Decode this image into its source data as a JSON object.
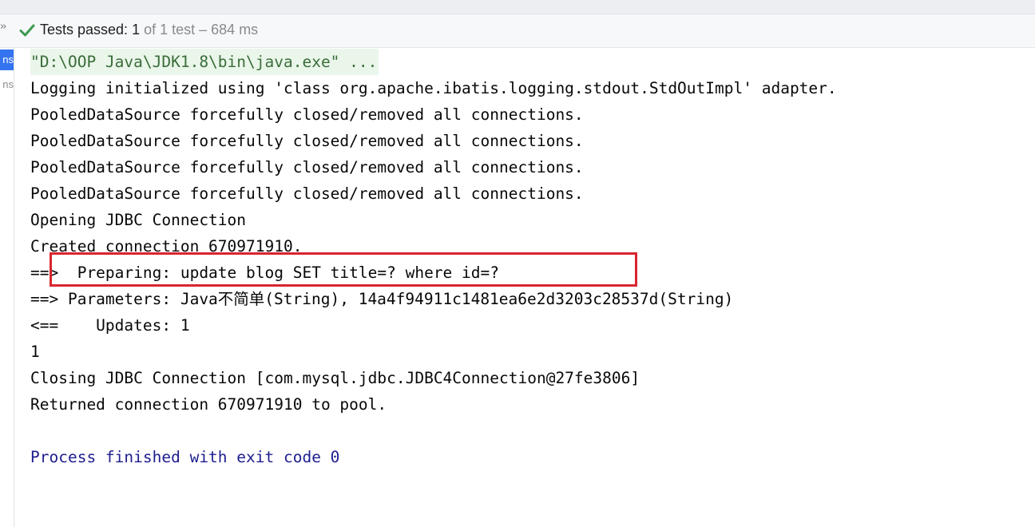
{
  "status": {
    "label": "Tests passed:",
    "passed": "1",
    "rest": "of 1 test – 684 ms"
  },
  "sidebar": {
    "active_label": "ns",
    "inactive_label": "ns"
  },
  "console": {
    "lines": [
      "\"D:\\OOP Java\\JDK1.8\\bin\\java.exe\" ...",
      "Logging initialized using 'class org.apache.ibatis.logging.stdout.StdOutImpl' adapter.",
      "PooledDataSource forcefully closed/removed all connections.",
      "PooledDataSource forcefully closed/removed all connections.",
      "PooledDataSource forcefully closed/removed all connections.",
      "PooledDataSource forcefully closed/removed all connections.",
      "Opening JDBC Connection",
      "Created connection 670971910.",
      "==>  Preparing: update blog SET title=? where id=?",
      "==> Parameters: Java不简单(String), 14a4f94911c1481ea6e2d3203c28537d(String)",
      "<==    Updates: 1",
      "1",
      "Closing JDBC Connection [com.mysql.jdbc.JDBC4Connection@27fe3806]",
      "Returned connection 670971910 to pool.",
      "",
      "Process finished with exit code 0"
    ]
  },
  "colors": {
    "check": "#3d9a50",
    "highlight_border": "#d9252e",
    "finished_text": "#1d1d8f",
    "command_bg": "#eaf6ea",
    "sidebar_active": "#3574f0"
  }
}
